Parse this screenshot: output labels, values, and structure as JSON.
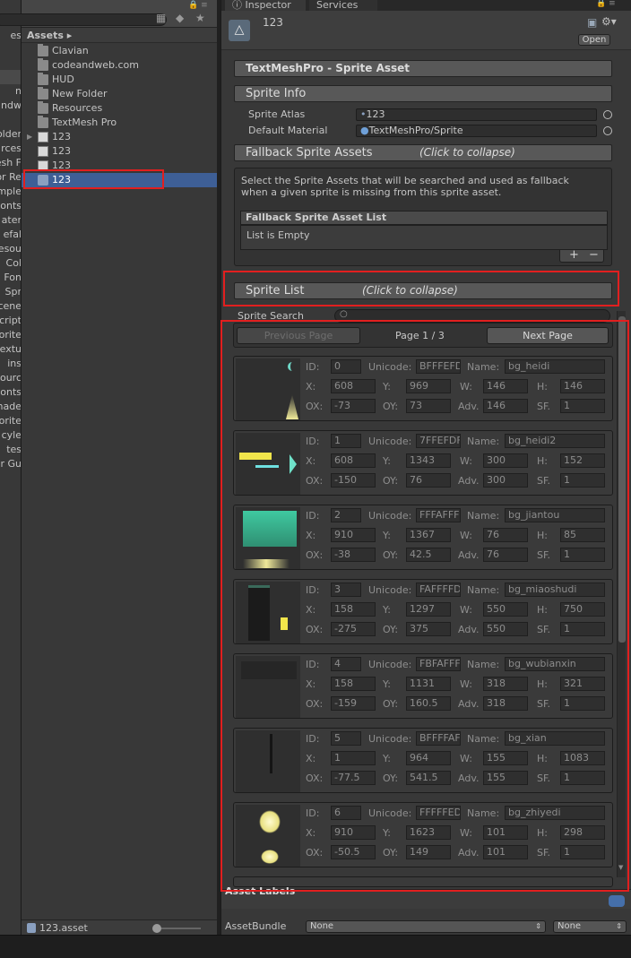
{
  "left_column": {
    "rows": [
      "es",
      "",
      "",
      "n",
      "ndw",
      "",
      "older",
      "rces",
      "esh F",
      "or Re",
      "mple",
      "onts",
      "ater",
      "efal",
      "esou",
      "Col",
      "Fon",
      "Spr",
      "cene",
      "cript",
      "orite",
      "extu",
      "ins",
      "ourc",
      "onts",
      "nade",
      "orite",
      "cyle",
      "tes",
      "r Gu"
    ]
  },
  "project": {
    "breadcrumb": "Assets ▸",
    "items": [
      {
        "label": "Clavian",
        "type": "folder"
      },
      {
        "label": "codeandweb.com",
        "type": "folder"
      },
      {
        "label": "HUD",
        "type": "folder"
      },
      {
        "label": "New Folder",
        "type": "folder"
      },
      {
        "label": "Resources",
        "type": "folder"
      },
      {
        "label": "TextMesh Pro",
        "type": "folder"
      },
      {
        "label": "123",
        "type": "file"
      },
      {
        "label": "123",
        "type": "file"
      },
      {
        "label": "123",
        "type": "file"
      },
      {
        "label": "123",
        "type": "asset"
      }
    ],
    "bottom_filename": "123.asset"
  },
  "inspector": {
    "tabs": {
      "inspector": "Inspector",
      "services": "Services"
    },
    "asset_name": "123",
    "open_label": "Open",
    "sections": {
      "asset_title": "TextMeshPro - Sprite Asset",
      "sprite_info": "Sprite Info",
      "fallback": "Fallback Sprite Assets",
      "fallback_hint": "(Click to collapse)",
      "sprite_list": "Sprite List",
      "sprite_list_hint": "(Click to collapse)"
    },
    "sprite_info": {
      "atlas_label": "Sprite Atlas",
      "atlas_value": "123",
      "material_label": "Default Material",
      "material_value": "TextMeshPro/Sprite"
    },
    "fallback": {
      "description_line1": "Select the Sprite Assets that will be searched and used as fallback",
      "description_line2": "when a given sprite is missing from this sprite asset.",
      "list_title": "Fallback Sprite Asset List",
      "list_empty": "List is Empty",
      "add": "+",
      "remove": "−"
    },
    "search_label": "Sprite Search",
    "pagination": {
      "prev": "Previous Page",
      "current": "Page 1 / 3",
      "next": "Next Page"
    },
    "field_labels": {
      "id": "ID:",
      "unicode": "Unicode:",
      "name": "Name:",
      "x": "X:",
      "y": "Y:",
      "w": "W:",
      "h": "H:",
      "ox": "OX:",
      "oy": "OY:",
      "adv": "Adv.",
      "sf": "SF."
    },
    "sprites": [
      {
        "id": "0",
        "unicode": "BFFFEFD",
        "name": "bg_heidi",
        "x": "608",
        "y": "969",
        "w": "146",
        "h": "146",
        "ox": "-73",
        "oy": "73",
        "adv": "146",
        "sf": "1"
      },
      {
        "id": "1",
        "unicode": "7FFEFDF",
        "name": "bg_heidi2",
        "x": "608",
        "y": "1343",
        "w": "300",
        "h": "152",
        "ox": "-150",
        "oy": "76",
        "adv": "300",
        "sf": "1"
      },
      {
        "id": "2",
        "unicode": "FFFAFFF",
        "name": "bg_jiantou",
        "x": "910",
        "y": "1367",
        "w": "76",
        "h": "85",
        "ox": "-38",
        "oy": "42.5",
        "adv": "76",
        "sf": "1"
      },
      {
        "id": "3",
        "unicode": "FAFFFFD",
        "name": "bg_miaoshudi",
        "x": "158",
        "y": "1297",
        "w": "550",
        "h": "750",
        "ox": "-275",
        "oy": "375",
        "adv": "550",
        "sf": "1"
      },
      {
        "id": "4",
        "unicode": "FBFAFFF",
        "name": "bg_wubianxin",
        "x": "158",
        "y": "1131",
        "w": "318",
        "h": "321",
        "ox": "-159",
        "oy": "160.5",
        "adv": "318",
        "sf": "1"
      },
      {
        "id": "5",
        "unicode": "BFFFFAF",
        "name": "bg_xian",
        "x": "1",
        "y": "964",
        "w": "155",
        "h": "1083",
        "ox": "-77.5",
        "oy": "541.5",
        "adv": "155",
        "sf": "1"
      },
      {
        "id": "6",
        "unicode": "FFFFFED",
        "name": "bg_zhiyedi",
        "x": "910",
        "y": "1623",
        "w": "101",
        "h": "298",
        "ox": "-50.5",
        "oy": "149",
        "adv": "101",
        "sf": "1"
      }
    ],
    "asset_labels": "Asset Labels",
    "assetbundle": {
      "label": "AssetBundle",
      "bundle": "None",
      "variant": "None"
    }
  },
  "colors": {
    "selection": "#3e5f96",
    "annotation": "#e21f1f",
    "panel": "#383838"
  }
}
